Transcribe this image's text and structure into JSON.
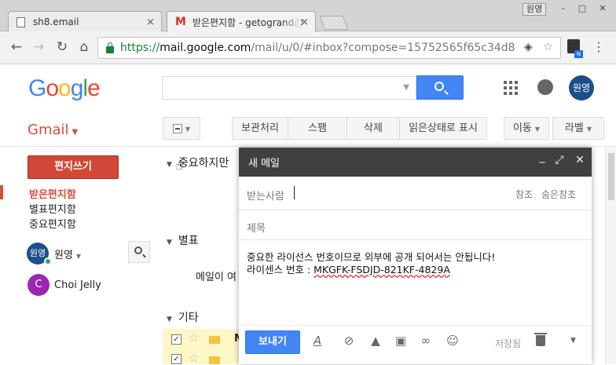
{
  "browser": {
    "tabs": [
      {
        "title": "sh8.email"
      },
      {
        "title": "받은편지함 - getogrand@"
      }
    ],
    "window_user": "원영",
    "url": {
      "scheme": "https://",
      "host": "mail.google.com",
      "path": "/mail/u/0/#inbox?compose=15752565f65c34d8"
    }
  },
  "header": {
    "logo_letters": [
      "G",
      "o",
      "o",
      "g",
      "l",
      "e"
    ],
    "avatar_text": "원영"
  },
  "gmail": {
    "label": "Gmail",
    "toolbar": {
      "archive": "보관처리",
      "spam": "스팸",
      "delete": "삭제",
      "mark_read": "읽은상태로 표시",
      "move": "이동",
      "labels": "라벨"
    },
    "compose_button": "편지쓰기",
    "nav": [
      "받은편지함",
      "별표편지함",
      "중요편지함"
    ],
    "hangouts": {
      "me_avatar": "원영",
      "me_name": "원영",
      "contacts": [
        {
          "initial": "C",
          "name": "Choi Jelly"
        }
      ]
    },
    "sections": {
      "important": "중요하지만",
      "starred": "별표",
      "starred_empty": "메일이 여",
      "other": "기타"
    },
    "row_sender_initial": "M"
  },
  "compose": {
    "title": "새 메일",
    "to_label": "받는사람",
    "cc_label": "참조",
    "bcc_label": "숨은참조",
    "subject_label": "제목",
    "body_line1": "중요한 라이선스 번호이므로 외부에 공개 되어서는 안됩니다!",
    "body_line2_prefix": "라이센스 번호 : ",
    "body_line2_code": "MKGFK-FSDJD-821KF-4829A",
    "send_label": "보내기",
    "saved_label": "저장됨"
  },
  "colors": {
    "accent": "#4285f4",
    "gmail_red": "#dd4b39",
    "compose_header": "#404040"
  }
}
